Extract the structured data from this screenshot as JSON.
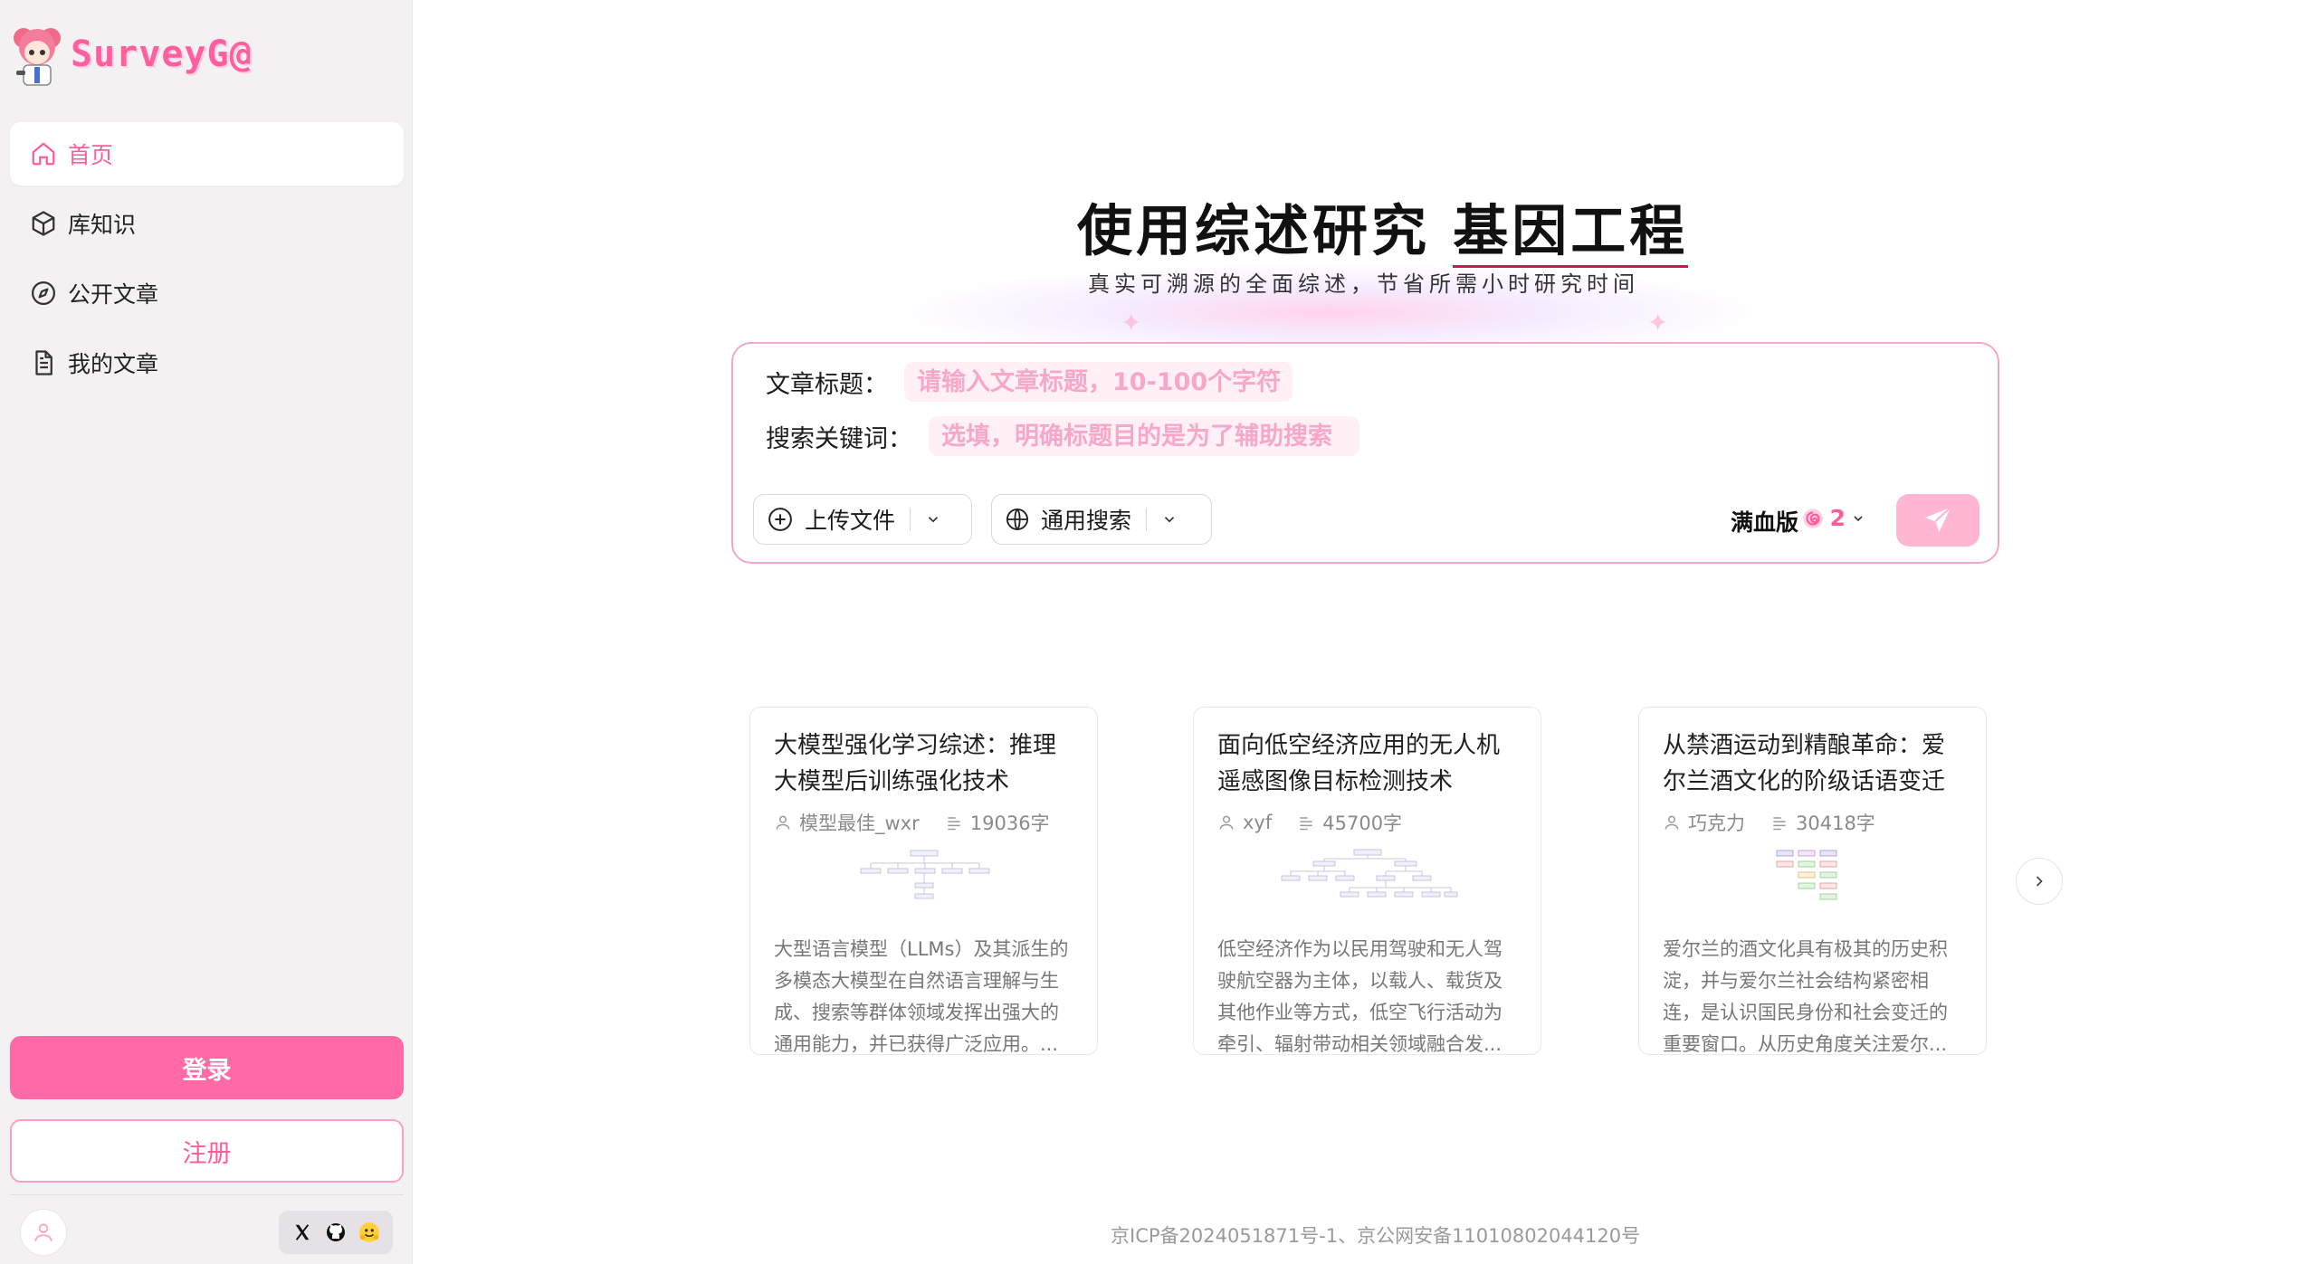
{
  "app": {
    "logo_text": "SurveyG@"
  },
  "sidebar": {
    "items": [
      {
        "label": "首页",
        "icon": "home-icon",
        "active": true
      },
      {
        "label": "库知识",
        "icon": "cube-icon",
        "active": false
      },
      {
        "label": "公开文章",
        "icon": "compass-icon",
        "active": false
      },
      {
        "label": "我的文章",
        "icon": "document-icon",
        "active": false
      }
    ],
    "login_label": "登录",
    "register_label": "注册",
    "social_icons": [
      "x-icon",
      "github-icon",
      "huggingface-icon"
    ]
  },
  "hero": {
    "title_prefix": "使用综述研究 ",
    "title_keyword": "基因工程",
    "subtitle": "真实可溯源的全面综述，节省所需小时研究时间"
  },
  "search": {
    "title_label": "文章标题：",
    "title_placeholder": "请输入文章标题，10-100个字符",
    "keywords_label": "搜索关键词：",
    "keywords_placeholder": "选填，明确标题目的是为了辅助搜索",
    "upload_label": "上传文件",
    "search_mode_label": "通用搜索",
    "plan_label": "满血版",
    "credits": "2"
  },
  "colors": {
    "accent": "#ff6aa6",
    "accent_light": "#ffb6d3",
    "sidebar_bg": "#f4f1f2"
  },
  "cards": [
    {
      "title": "大模型强化学习综述：推理大模型后训练强化技术",
      "author": "模型最佳_wxr",
      "words": "19036字",
      "desc": "大型语言模型（LLMs）及其派生的多模态大模型在自然语言理解与生成、搜索等群体领域发挥出强大的通用能力，并已获得广泛应用。..."
    },
    {
      "title": "面向低空经济应用的无人机遥感图像目标检测技术",
      "author": "xyf",
      "words": "45700字",
      "desc": "低空经济作为以民用驾驶和无人驾驶航空器为主体，以载人、载货及其他作业等方式，低空飞行活动为牵引、辐射带动相关领域融合发..."
    },
    {
      "title": "从禁酒运动到精酿革命：爱尔兰酒文化的阶级话语变迁",
      "author": "巧克力",
      "words": "30418字",
      "desc": "爱尔兰的酒文化具有极其的历史积淀，并与爱尔兰社会结构紧密相连，是认识国民身份和社会变迁的重要窗口。从历史角度关注爱尔..."
    }
  ],
  "footer": {
    "text": "京ICP备2024051871号-1、京公网安备11010802044120号"
  }
}
